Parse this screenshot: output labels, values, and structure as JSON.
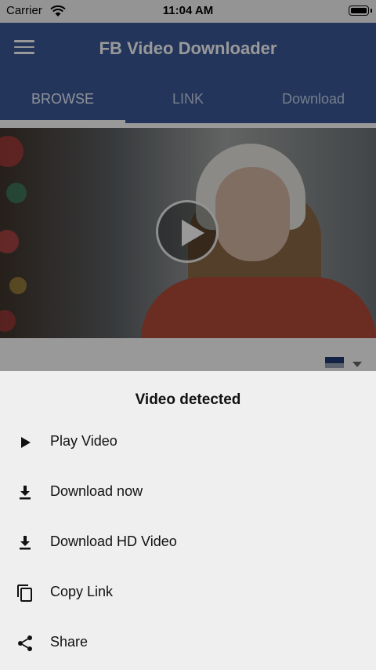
{
  "status_bar": {
    "carrier": "Carrier",
    "time": "11:04 AM"
  },
  "app_bar": {
    "title": "FB Video Downloader",
    "menu_icon": "hamburger-menu-icon",
    "bg_color": "#3b5998"
  },
  "tabs": [
    {
      "label": "BROWSE",
      "active": true
    },
    {
      "label": "LINK",
      "active": false
    },
    {
      "label": "Download",
      "active": false
    }
  ],
  "content": {
    "play_icon": "play-circle-icon"
  },
  "sheet": {
    "title": "Video detected",
    "items": [
      {
        "label": "Play Video",
        "icon": "play-icon"
      },
      {
        "label": "Download now",
        "icon": "download-icon"
      },
      {
        "label": "Download HD Video",
        "icon": "download-icon"
      },
      {
        "label": "Copy Link",
        "icon": "copy-icon"
      },
      {
        "label": "Share",
        "icon": "share-icon"
      }
    ]
  }
}
